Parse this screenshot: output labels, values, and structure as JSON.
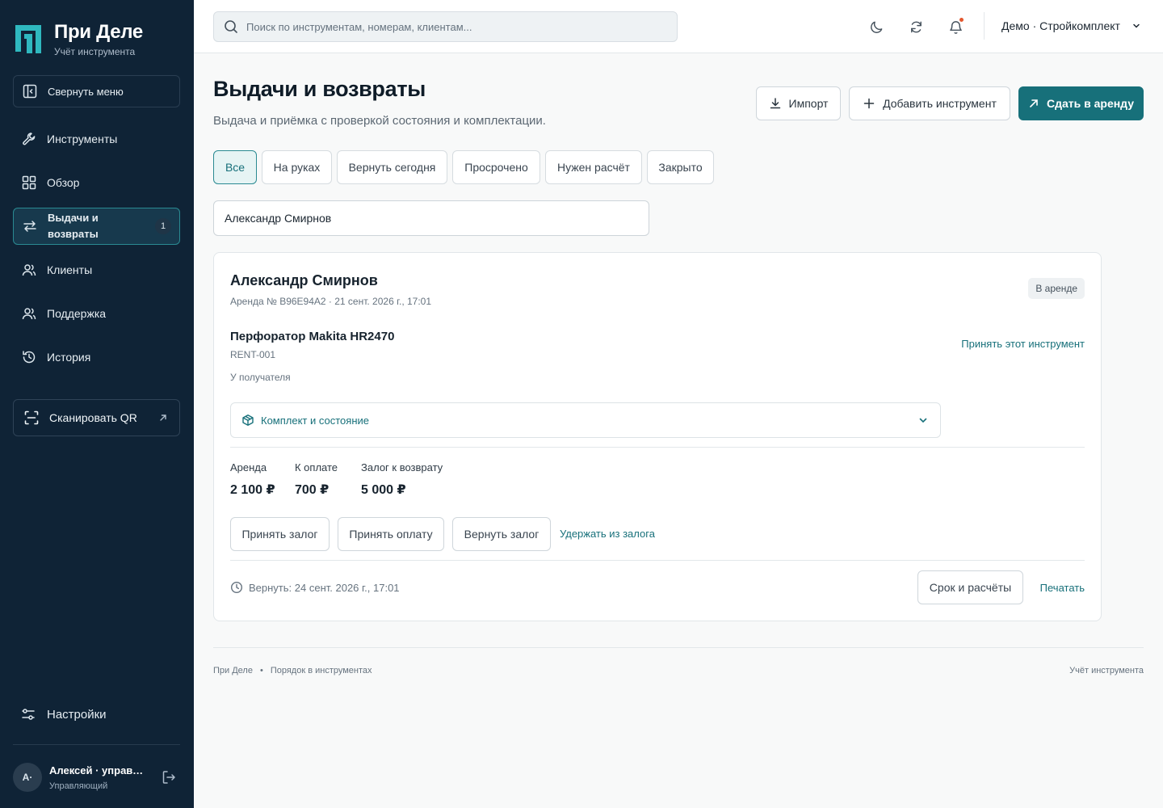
{
  "brand": {
    "name": "При Деле",
    "subtitle": "Учёт инструмента"
  },
  "sidebar": {
    "collapse_label": "Свернуть меню",
    "items": [
      {
        "label": "Инструменты",
        "icon": "wrench-icon"
      },
      {
        "label": "Обзор",
        "icon": "grid-icon"
      },
      {
        "label": "Выдачи и возвраты",
        "icon": "swap-arrows-icon",
        "badge": "1",
        "active": true
      },
      {
        "label": "Клиенты",
        "icon": "users-icon"
      },
      {
        "label": "Поддержка",
        "icon": "users-icon"
      },
      {
        "label": "История",
        "icon": "history-icon"
      }
    ],
    "scan_label": "Сканировать QR",
    "settings_label": "Настройки",
    "user": {
      "initials": "А·",
      "name": "Алексей · управляющий",
      "role": "Управляющий"
    }
  },
  "topbar": {
    "search_placeholder": "Поиск по инструментам, номерам, клиентам...",
    "account": "Демо · Стройкомплект"
  },
  "page": {
    "title": "Выдачи и возвраты",
    "subtitle": "Выдача и приёмка с проверкой состояния и комплектации.",
    "actions": {
      "import": "Импорт",
      "add_tool": "Добавить инструмент",
      "rent_out": "Сдать в аренду"
    },
    "filters": [
      "Все",
      "На руках",
      "Вернуть сегодня",
      "Просрочено",
      "Нужен расчёт",
      "Закрыто"
    ],
    "active_filter": "Все",
    "client_query": "Александр Смирнов"
  },
  "rental": {
    "client": "Александр Смирнов",
    "meta": "Аренда № B96E94A2 · 21 сент. 2026 г., 17:01",
    "status": "В аренде",
    "tool_name": "Перфоратор Makita HR2470",
    "tool_code": "RENT-001",
    "tool_state": "У получателя",
    "accept_link": "Принять этот инструмент",
    "accordion_label": "Комплект и состояние",
    "money": [
      {
        "label": "Аренда",
        "value": "2 100 ₽"
      },
      {
        "label": "К оплате",
        "value": "700 ₽"
      },
      {
        "label": "Залог к возврату",
        "value": "5 000 ₽"
      }
    ],
    "buttons": {
      "accept_deposit": "Принять залог",
      "accept_payment": "Принять оплату",
      "return_deposit": "Вернуть залог",
      "hold_deposit": "Удержать из залога"
    },
    "return_date": "Вернуть: 24 сент. 2026 г., 17:01",
    "terms_button": "Срок и расчёты",
    "print_link": "Печатать"
  },
  "footer": {
    "left_1": "При Деле",
    "left_2": "Порядок в инструментах",
    "right": "Учёт инструмента"
  },
  "colors": {
    "sidebar_bg": "#0f2336",
    "accent": "#17707a",
    "page_bg": "#f8f9f9"
  }
}
